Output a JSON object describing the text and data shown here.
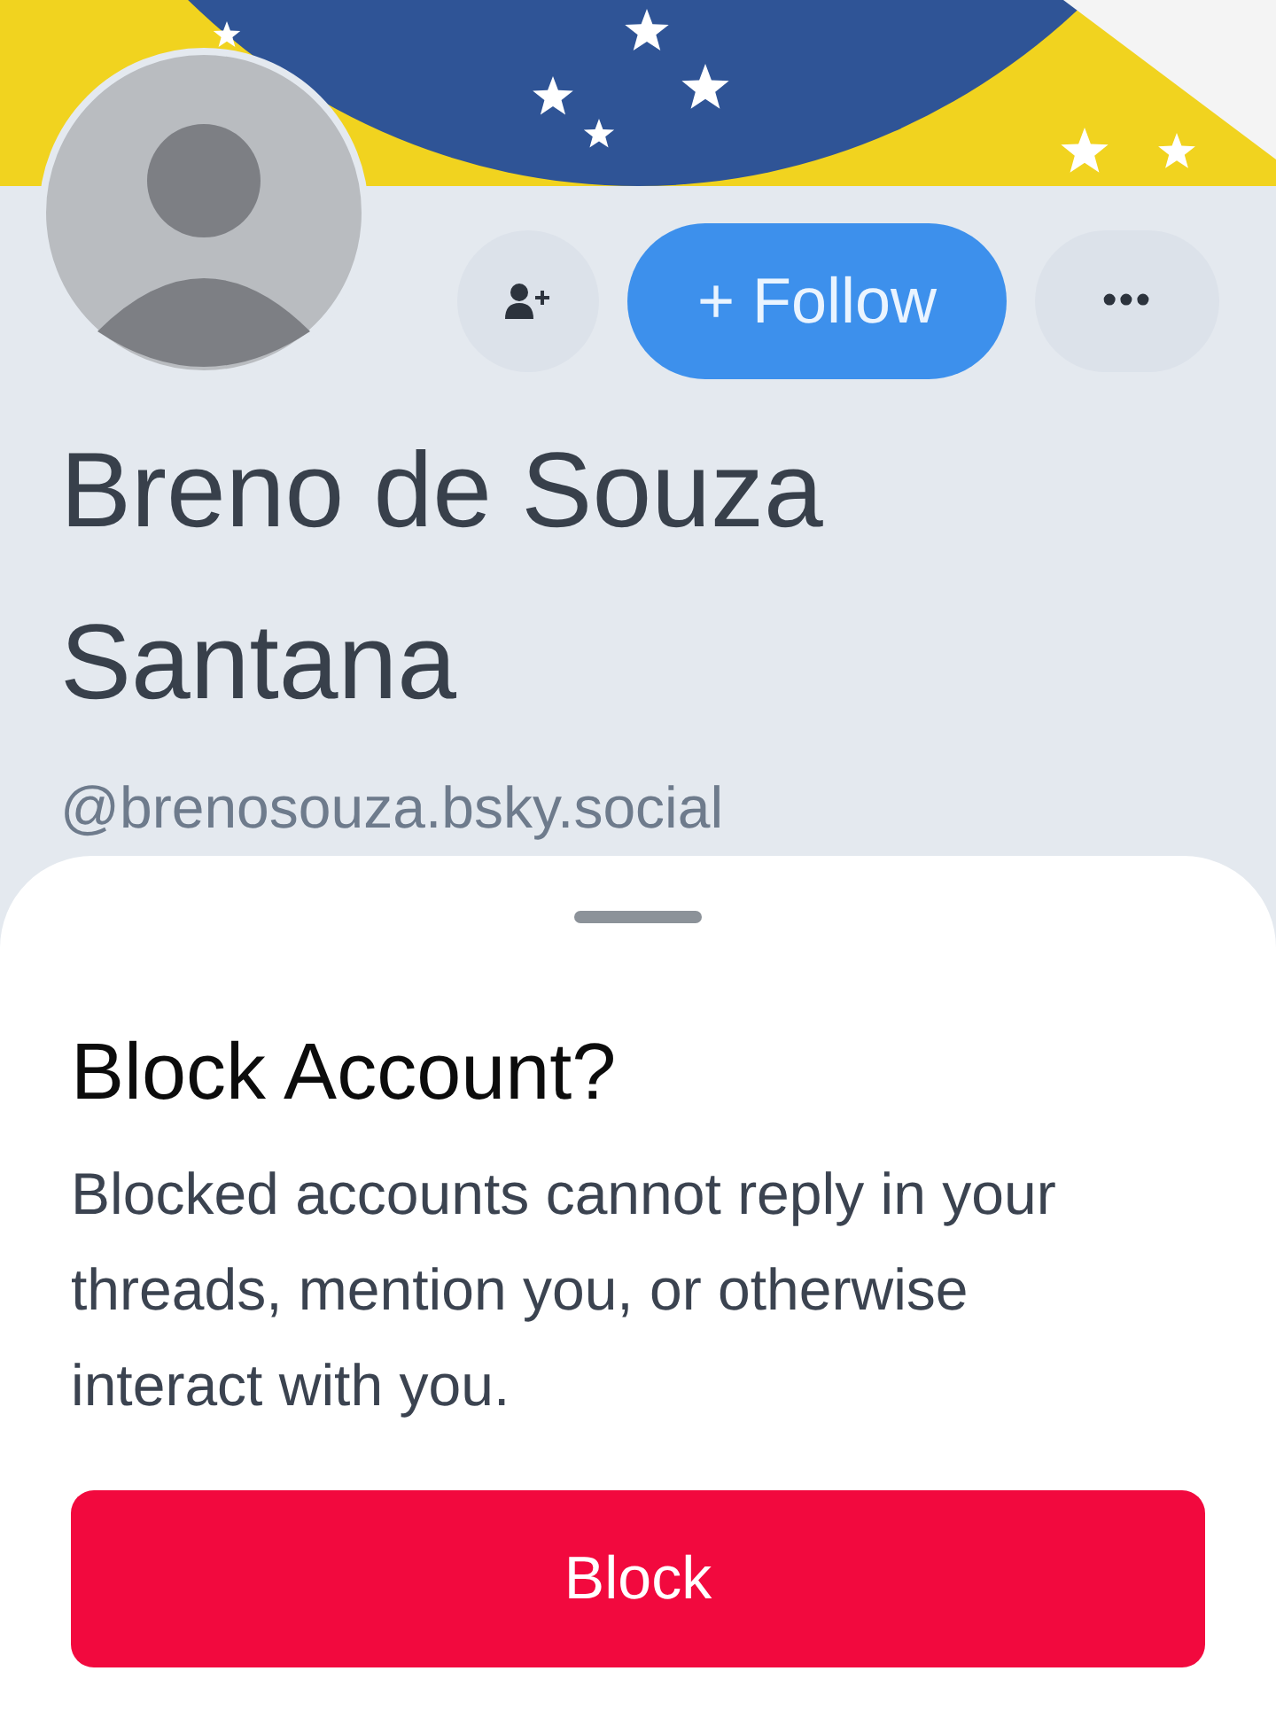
{
  "profile": {
    "follow_button": "+ Follow",
    "more_button": "•••",
    "name": "Breno de Souza Santana",
    "handle": "@brenosouza.bsky.social"
  },
  "sheet": {
    "title": "Block Account?",
    "message": "Blocked accounts cannot reply in your threads, mention you, or otherwise interact with you.",
    "confirm_button": "Block"
  }
}
